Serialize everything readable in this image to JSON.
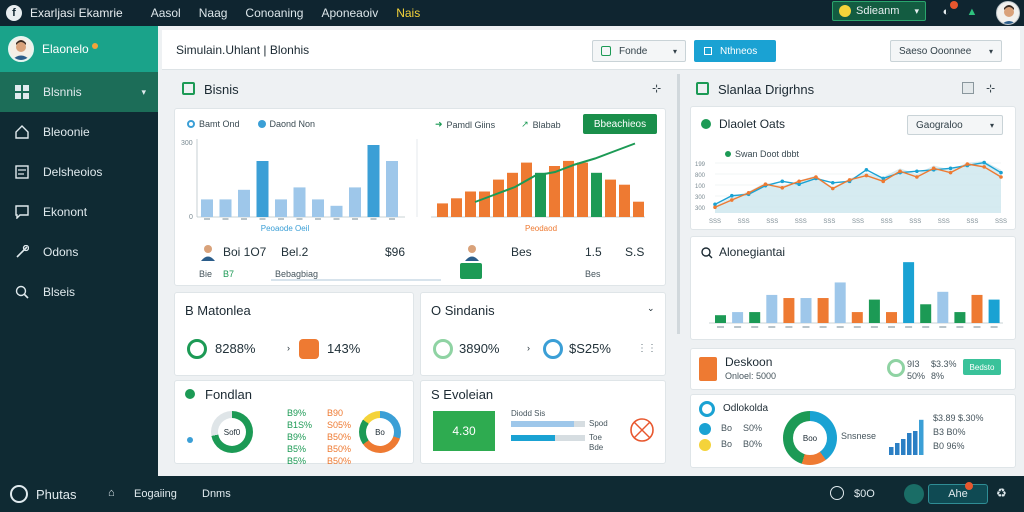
{
  "topbar": {
    "app_title": "Exarljasi Ekamrie",
    "logo_glyph": "f",
    "menu": [
      "Aasol",
      "Naag",
      "Conoaning",
      "Aponeaoiv",
      "Nais"
    ],
    "user_select": "Sdieanm",
    "user_select_chev": "▾",
    "bell_icon": "◐",
    "bag_icon": "▲",
    "accent": "#f4d33a"
  },
  "sidebar": {
    "profile_name": "Elaonelo",
    "items": [
      {
        "label": "Blsnnis",
        "icon": "grid-icon"
      },
      {
        "label": "Bleoonie",
        "icon": "home-icon"
      },
      {
        "label": "Delsheoios",
        "icon": "card-icon"
      },
      {
        "label": "Ekonont",
        "icon": "chat-icon"
      },
      {
        "label": "Odons",
        "icon": "tools-icon"
      },
      {
        "label": "Blseis",
        "icon": "search-icon"
      }
    ],
    "active_chev": "▾"
  },
  "subheader": {
    "breadcrumb": "Simulain.Uhlant | Blonhis",
    "btn1": "Fonde",
    "btn1_chev": "▾",
    "btn2": "Nthneos",
    "btn3": "Saeso Ooonnee",
    "btn3_chev": "▾"
  },
  "business_panel": {
    "title": "Bisnis",
    "pin": "⊹",
    "legend_left": [
      "Bamt Ond",
      "Daond Non"
    ],
    "legend_right": [
      "Pamdl Giins",
      "Blabab"
    ],
    "button": "Bbeachieos",
    "y_axis_top": "300",
    "y_axis_zero": "0",
    "left_xlabel": "Peoaode Oeil",
    "right_xlabel": "Peodaod",
    "left_chart_values": [
      22,
      22,
      34,
      70,
      22,
      37,
      22,
      14,
      37,
      90,
      70
    ],
    "left_chart_highlight": [
      0,
      0,
      0,
      1,
      0,
      0,
      0,
      0,
      0,
      1,
      0
    ],
    "right_chart_values": [
      16,
      22,
      30,
      30,
      44,
      52,
      64,
      52,
      60,
      66,
      64,
      52,
      44,
      38,
      18
    ],
    "right_chart_highlight": [
      0,
      0,
      0,
      0,
      0,
      0,
      0,
      1,
      0,
      0,
      0,
      1,
      0,
      0,
      0
    ],
    "trend_values": [
      20,
      30,
      40,
      55,
      60,
      70,
      78,
      88,
      98
    ],
    "stats_left": {
      "a": "Boi 1O7",
      "b": "Bel.2",
      "c": "$96",
      "row2": [
        "Bie",
        "B7",
        "Bebagbiag"
      ]
    },
    "stats_right": {
      "a": "Bes",
      "b": "1.5",
      "c": "S.S",
      "row2": [
        "Bes"
      ]
    }
  },
  "motionles_panel": {
    "title": "B Matonlea",
    "stat1": "8288%",
    "stat2": "143%"
  },
  "sindanis_panel": {
    "title": "O Sindanis",
    "stat1": "3890%",
    "stat2": "$S25%",
    "grip": "⋮⋮"
  },
  "fondlan_panel": {
    "title": "Fondlan",
    "donut_label": "Sof0",
    "donut2_label": "Bo",
    "rows": [
      [
        "B9%",
        "B90"
      ],
      [
        "B1S%",
        "S05%"
      ],
      [
        "B9%",
        "B50%"
      ],
      [
        "B5%",
        "B50%"
      ],
      [
        "B5%",
        "B50%"
      ]
    ]
  },
  "evoleian_panel": {
    "title": "S Evoleian",
    "box_value": "4.30",
    "legend": "Diodd Sis",
    "progress_labels": [
      "Spod",
      "Toe",
      "Bde"
    ],
    "progress_values": [
      0.85,
      0.6
    ]
  },
  "signs_panel": {
    "title": "Slanlaa Drigrhns",
    "pin": "⊹"
  },
  "line_panel": {
    "title": "Dlaolet Oats",
    "dropdown": "Gaograloo",
    "dropdown_chev": "▾",
    "legend": "Swan Doot dbbt",
    "y_ticks": [
      "199",
      "800",
      "100",
      "300",
      "300"
    ],
    "x_ticks": [
      "SSS",
      "SSS",
      "SSS",
      "SSS",
      "SSS",
      "SSS",
      "SSS",
      "SSS",
      "SSS",
      "SSS",
      "SSS"
    ],
    "area_values": [
      10,
      22,
      30,
      42,
      38,
      45,
      52,
      36,
      48,
      56,
      50,
      62,
      54,
      66,
      60,
      70,
      72,
      60
    ],
    "orange_values": [
      8,
      18,
      28,
      40,
      35,
      44,
      50,
      34,
      46,
      52,
      44,
      58,
      50,
      62,
      56,
      68,
      64,
      50
    ],
    "teal_values": [
      12,
      24,
      26,
      38,
      44,
      40,
      48,
      42,
      44,
      60,
      48,
      56,
      58,
      60,
      62,
      66,
      70,
      56
    ]
  },
  "alone_panel": {
    "title": "Alonegiantai",
    "values": [
      10,
      14,
      14,
      36,
      32,
      32,
      32,
      52,
      14,
      30,
      14,
      78,
      24,
      40,
      14,
      36,
      30
    ],
    "colors": [
      "g",
      "b",
      "g",
      "b",
      "o",
      "b",
      "o",
      "b",
      "o",
      "g",
      "o",
      "t",
      "g",
      "b",
      "g",
      "o",
      "t"
    ]
  },
  "deskoon_panel": {
    "title": "Deskoon",
    "sub": "Onloel: 5000",
    "pct1": "9I3",
    "pct1b": "50%",
    "pct2": "$3.3%",
    "pct2b": "8%",
    "btn": "Bedsto"
  },
  "odlokolda_panel": {
    "title": "Odlokolda",
    "rows": [
      [
        "Bo",
        "S0%"
      ],
      [
        "Bo",
        "B0%"
      ]
    ],
    "donut_center": "Boo",
    "legend": "Snsnese",
    "right_rows": [
      "$3.89 $.30%",
      "B3 B0%",
      "B0 96%"
    ],
    "bars": [
      20,
      30,
      40,
      55,
      60,
      88
    ]
  },
  "footer": {
    "brand": "Phutas",
    "items": [
      "Eogaiing",
      "Dnms"
    ],
    "clock": "$0O",
    "pill": "Ahe",
    "extra_icon": "♻"
  },
  "colors": {
    "green": "#1c9a55",
    "orange": "#ee7a32",
    "blue": "#3b9fd6",
    "lightblue": "#9ec7ea",
    "teal": "#1aa2d3",
    "darknav": "#0f2a33"
  }
}
